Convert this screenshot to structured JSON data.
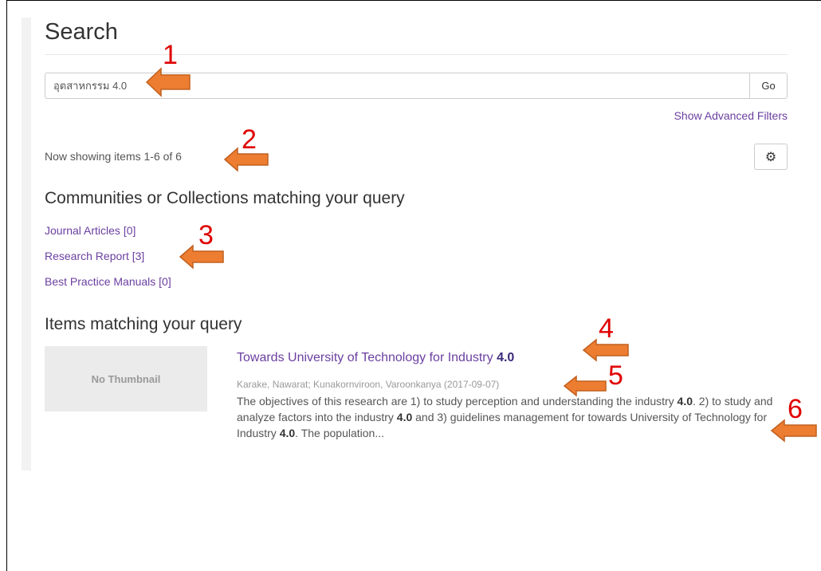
{
  "page": {
    "title": "Search"
  },
  "search": {
    "query": "อุตสาหกรรม 4.0",
    "go_label": "Go",
    "advanced_filters_label": "Show Advanced Filters"
  },
  "results": {
    "count_text": "Now showing items 1-6 of 6",
    "settings_icon": "gear-icon"
  },
  "collections": {
    "heading": "Communities or Collections matching your query",
    "links": [
      {
        "label": "Journal Articles [0]"
      },
      {
        "label": "Research Report [3]"
      },
      {
        "label": "Best Practice Manuals [0]"
      }
    ]
  },
  "items": {
    "heading": "Items matching your query",
    "list": [
      {
        "thumbnail_text": "No Thumbnail",
        "title_text": "Towards University of Technology for Industry ",
        "title_highlight": "4.0",
        "meta": "Karake, Nawarat; Kunakornviroon, Varoonkanya (2017-09-07)",
        "abstract_parts": [
          {
            "text": "The objectives of this research are 1) to study perception and understanding the industry ",
            "bold": false
          },
          {
            "text": "4.0",
            "bold": true
          },
          {
            "text": ". 2) to study and analyze factors into the industry ",
            "bold": false
          },
          {
            "text": "4.0",
            "bold": true
          },
          {
            "text": " and 3) guidelines management for towards University of Technology for Industry ",
            "bold": false
          },
          {
            "text": "4.0",
            "bold": true
          },
          {
            "text": ". The population...",
            "bold": false
          }
        ]
      }
    ]
  },
  "annotations": {
    "numbers": [
      "1",
      "2",
      "3",
      "4",
      "5",
      "6"
    ],
    "number_color": "#e00000",
    "arrow_color": "#ed7d31"
  },
  "colors": {
    "link": "#6b3fa0",
    "text": "#333333",
    "muted": "#999999"
  }
}
